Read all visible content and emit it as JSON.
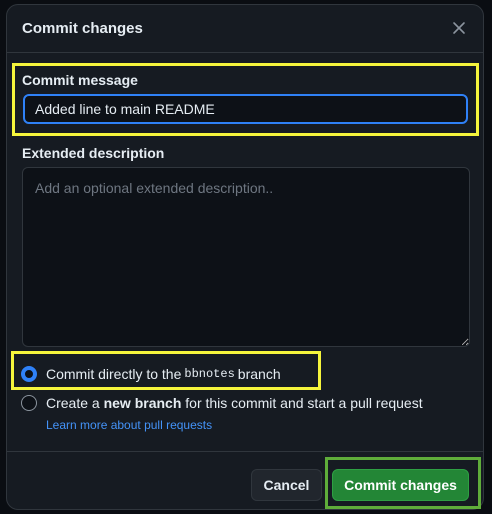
{
  "dialog": {
    "title": "Commit changes",
    "close_icon": "x-icon"
  },
  "commit_message": {
    "label": "Commit message",
    "value": "Added line to main README"
  },
  "extended_description": {
    "label": "Extended description",
    "placeholder": "Add an optional extended description.."
  },
  "options": {
    "direct": {
      "prefix": "Commit directly to the",
      "branch": "bbnotes",
      "suffix": "branch",
      "selected": true
    },
    "new_branch": {
      "prefix": "Create a",
      "bold": "new branch",
      "suffix": "for this commit and start a pull request",
      "selected": false
    },
    "learn_more": "Learn more about pull requests"
  },
  "footer": {
    "cancel_label": "Cancel",
    "commit_label": "Commit changes"
  },
  "colors": {
    "highlight_yellow": "#f5f53c",
    "highlight_green": "#5fad3a",
    "primary_button": "#238636",
    "focus_blue": "#2f81f7",
    "link": "#4493f8"
  }
}
